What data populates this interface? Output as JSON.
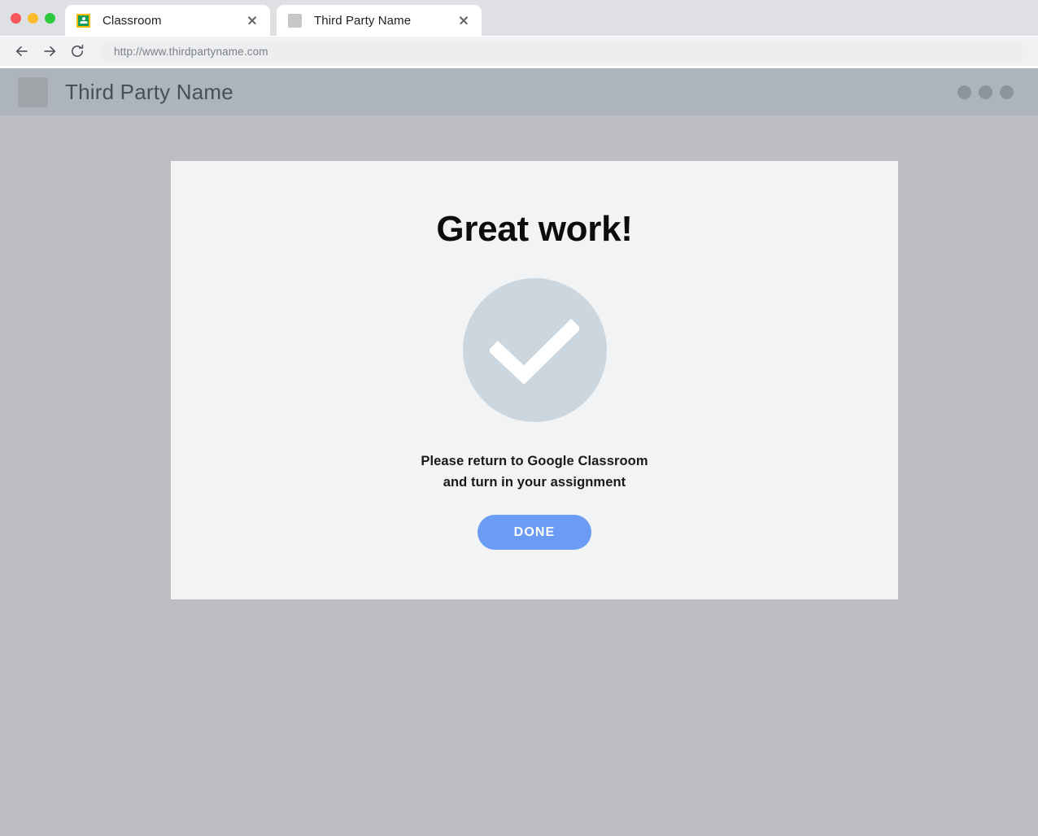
{
  "window": {
    "traffic_lights": [
      {
        "name": "close",
        "color": "#f9575a"
      },
      {
        "name": "minimize",
        "color": "#fcbc2e"
      },
      {
        "name": "zoom",
        "color": "#2cc93f"
      }
    ]
  },
  "tabs": [
    {
      "title": "Classroom",
      "favicon": "google-classroom-icon",
      "active": false
    },
    {
      "title": "Third Party Name",
      "favicon": "placeholder-square-icon",
      "active": true
    }
  ],
  "toolbar": {
    "back_icon": "arrow-left-icon",
    "forward_icon": "arrow-right-icon",
    "reload_icon": "reload-icon",
    "url": "http://www.thirdpartyname.com"
  },
  "site_header": {
    "logo_icon": "placeholder-logo-icon",
    "title": "Third Party Name",
    "menu_dots": 3
  },
  "card": {
    "heading": "Great work!",
    "check_icon": "check-circle-icon",
    "message_line_1": "Please return to Google Classroom",
    "message_line_2": "and turn in your assignment",
    "button_label": "DONE"
  },
  "colors": {
    "page_background": "#bcbec1",
    "card_background": "#f1f3f4",
    "header_background": "#aeb4bd",
    "accent_button": "#6a9cf5",
    "check_circle": "#ccd6de",
    "tabstrip": "#dee0e3",
    "toolbar": "#f1f2f4"
  }
}
